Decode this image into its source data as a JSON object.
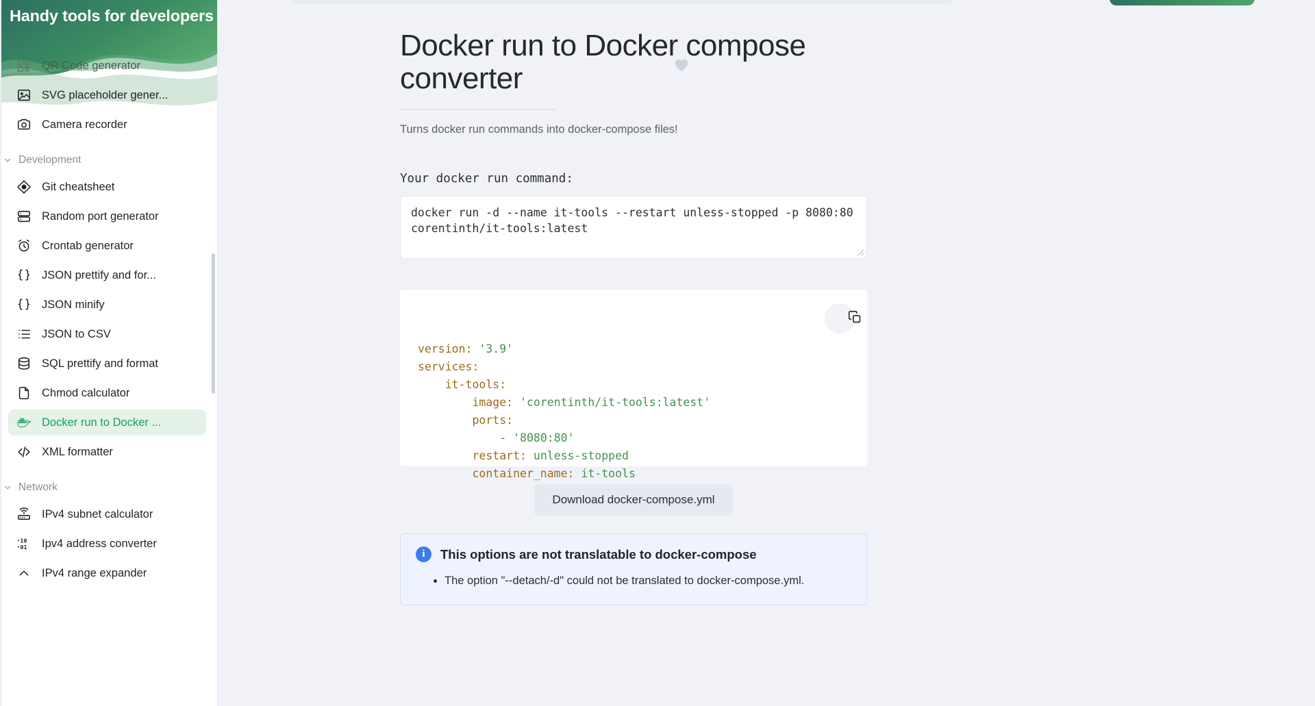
{
  "sidebar": {
    "title": "Handy tools for developers",
    "top_items": [
      {
        "label": "QR Code generator",
        "icon": "qr-code-icon"
      },
      {
        "label": "SVG placeholder gener...",
        "icon": "image-icon"
      },
      {
        "label": "Camera recorder",
        "icon": "camera-icon"
      }
    ],
    "groups": [
      {
        "label": "Development",
        "items": [
          {
            "label": "Git cheatsheet",
            "icon": "git-icon"
          },
          {
            "label": "Random port generator",
            "icon": "server-icon"
          },
          {
            "label": "Crontab generator",
            "icon": "alarm-clock-icon"
          },
          {
            "label": "JSON prettify and for...",
            "icon": "braces-icon"
          },
          {
            "label": "JSON minify",
            "icon": "braces-icon"
          },
          {
            "label": "JSON to CSV",
            "icon": "list-icon"
          },
          {
            "label": "SQL prettify and format",
            "icon": "database-icon"
          },
          {
            "label": "Chmod calculator",
            "icon": "file-icon"
          },
          {
            "label": "Docker run to Docker ...",
            "icon": "docker-icon",
            "active": true
          },
          {
            "label": "XML formatter",
            "icon": "code-icon"
          }
        ]
      },
      {
        "label": "Network",
        "items": [
          {
            "label": "IPv4 subnet calculator",
            "icon": "router-icon"
          },
          {
            "label": "Ipv4 address converter",
            "icon": "binary-icon"
          },
          {
            "label": "IPv4 range expander",
            "icon": "chevron-up-icon"
          }
        ]
      }
    ]
  },
  "page": {
    "title": "Docker run to Docker compose converter",
    "subtitle": "Turns docker run commands into docker-compose files!",
    "favorite_icon": "heart-icon"
  },
  "input": {
    "label": "Your docker run command:",
    "value": "docker run -d --name it-tools --restart unless-stopped -p 8080:80 corentinth/it-tools:latest",
    "placeholder": "Your docker run command..."
  },
  "output": {
    "copy_icon": "copy-icon",
    "lines": [
      [
        {
          "t": "version:",
          "c": "key"
        },
        {
          "t": " ",
          "c": "plain"
        },
        {
          "t": "'3.9'",
          "c": "str"
        }
      ],
      [
        {
          "t": "services:",
          "c": "key"
        }
      ],
      [
        {
          "t": "    it-tools:",
          "c": "key"
        }
      ],
      [
        {
          "t": "        image:",
          "c": "key"
        },
        {
          "t": " ",
          "c": "plain"
        },
        {
          "t": "'corentinth/it-tools:latest'",
          "c": "str"
        }
      ],
      [
        {
          "t": "        ports:",
          "c": "key"
        }
      ],
      [
        {
          "t": "            ",
          "c": "plain"
        },
        {
          "t": "-",
          "c": "dash"
        },
        {
          "t": " ",
          "c": "plain"
        },
        {
          "t": "'8080:80'",
          "c": "str"
        }
      ],
      [
        {
          "t": "        restart:",
          "c": "key"
        },
        {
          "t": " ",
          "c": "plain"
        },
        {
          "t": "unless-stopped",
          "c": "str"
        }
      ],
      [
        {
          "t": "        container_name:",
          "c": "key"
        },
        {
          "t": " ",
          "c": "plain"
        },
        {
          "t": "it-tools",
          "c": "str"
        }
      ]
    ]
  },
  "download": {
    "label": "Download docker-compose.yml"
  },
  "alert": {
    "icon": "info-icon",
    "title": "This options are not translatable to docker-compose",
    "items": [
      "The option \"--detach/-d\" could not be translated to docker-compose.yml."
    ]
  },
  "colors": {
    "accent_green": "#18a058",
    "active_bg": "#e4f2e8",
    "page_bg": "#f1f2f8",
    "yaml_key": "#9c6b1f",
    "yaml_string": "#44914f",
    "yaml_dash": "#4f6ae0",
    "info_blue": "#3b7ceb"
  }
}
